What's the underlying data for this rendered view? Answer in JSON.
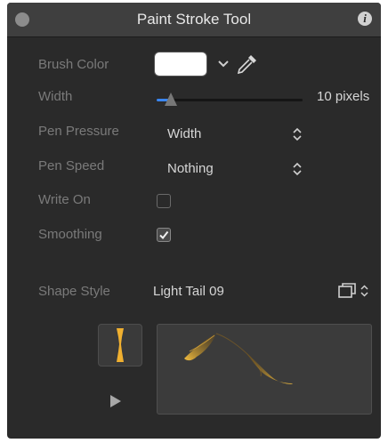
{
  "window": {
    "title": "Paint Stroke Tool"
  },
  "brush_color": {
    "label": "Brush Color",
    "color": "#ffffff"
  },
  "width": {
    "label": "Width",
    "value_text": "10 pixels",
    "level": 0.1
  },
  "pen_pressure": {
    "label": "Pen Pressure",
    "value": "Width"
  },
  "pen_speed": {
    "label": "Pen Speed",
    "value": "Nothing"
  },
  "write_on": {
    "label": "Write On",
    "checked": false
  },
  "smoothing": {
    "label": "Smoothing",
    "checked": true
  },
  "shape_style": {
    "label": "Shape Style",
    "value": "Light Tail 09"
  },
  "icons": [
    "close-icon",
    "info-icon",
    "chevron-down-icon",
    "eyedropper-icon",
    "updown-arrows-icon",
    "preset-browser-icon",
    "play-icon"
  ],
  "colors": {
    "accent": "#3a86f0",
    "stroke_gold": "#f0b030",
    "panel_bg": "#2a2a2a"
  }
}
